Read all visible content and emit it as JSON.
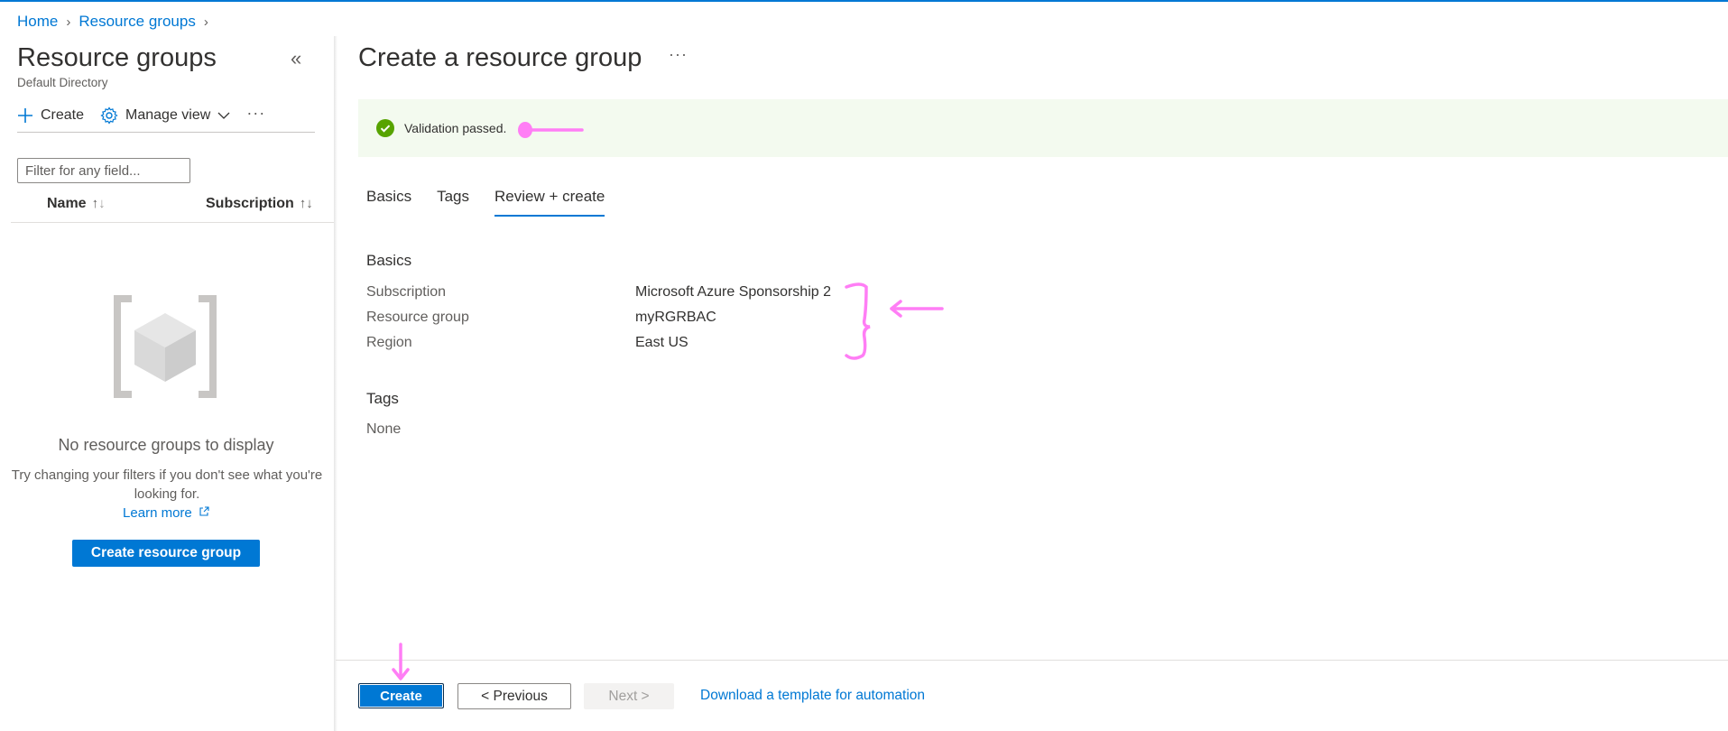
{
  "breadcrumb": {
    "home": "Home",
    "resource_groups": "Resource groups"
  },
  "left": {
    "title": "Resource groups",
    "subtitle": "Default Directory",
    "toolbar": {
      "create": "Create",
      "manage_view": "Manage view"
    },
    "filter_placeholder": "Filter for any field...",
    "columns": {
      "name": "Name",
      "subscription": "Subscription"
    },
    "empty": {
      "title": "No resource groups to display",
      "description": "Try changing your filters if you don't see what you're looking for.",
      "learn_more": "Learn more"
    },
    "create_rg_button": "Create resource group"
  },
  "main": {
    "title": "Create a resource group",
    "validation": "Validation passed.",
    "tabs": [
      "Basics",
      "Tags",
      "Review + create"
    ],
    "active_tab": "Review + create",
    "basics": {
      "heading": "Basics",
      "rows": [
        {
          "label": "Subscription",
          "value": "Microsoft Azure Sponsorship 2"
        },
        {
          "label": "Resource group",
          "value": "myRGRBAC"
        },
        {
          "label": "Region",
          "value": "East US"
        }
      ]
    },
    "tags": {
      "heading": "Tags",
      "value": "None"
    }
  },
  "footer": {
    "create": "Create",
    "previous": "< Previous",
    "next": "Next >",
    "download": "Download a template for automation"
  },
  "colors": {
    "accent": "#0078d4",
    "success": "#57a300",
    "banner_bg": "#f3faef",
    "annotation": "#ff7ef5"
  }
}
